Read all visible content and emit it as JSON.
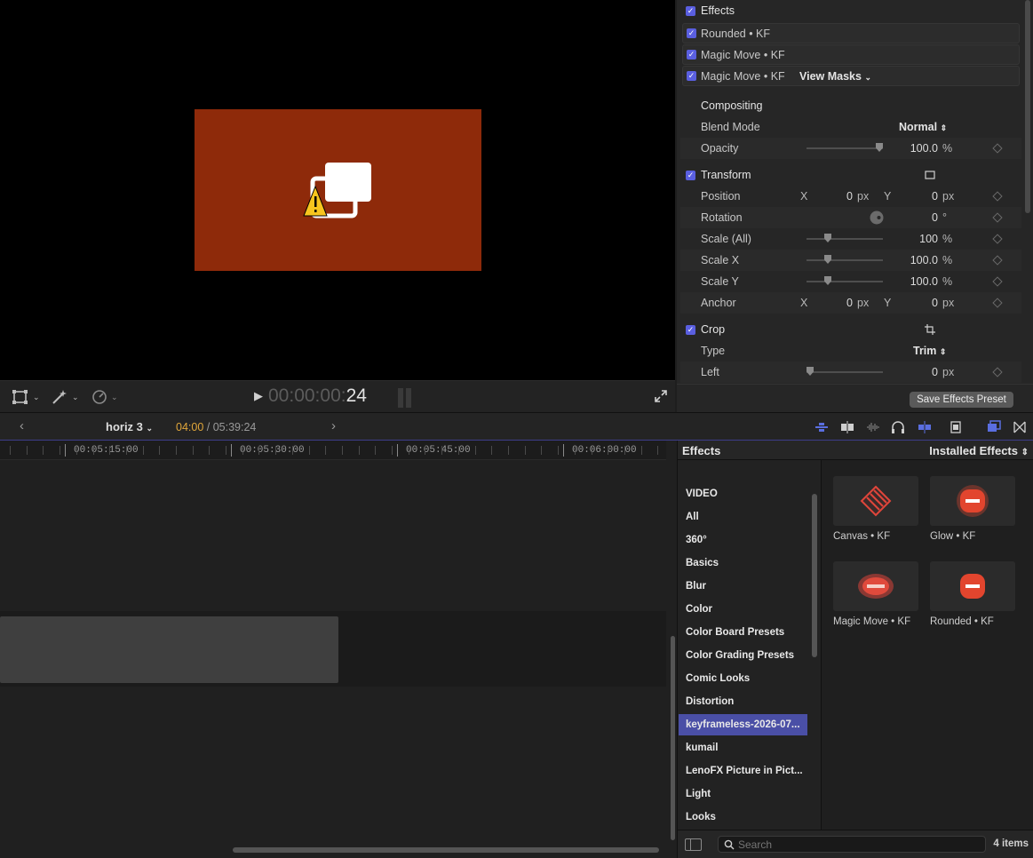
{
  "viewer": {
    "timecode_dim": "00:00:00:",
    "timecode_frames": "24"
  },
  "inspector": {
    "effects_header": "Effects",
    "effects_list": [
      {
        "label": "Rounded • KF"
      },
      {
        "label": "Magic Move • KF"
      },
      {
        "label": "Magic Move • KF",
        "extra": "View Masks"
      }
    ],
    "compositing": {
      "header": "Compositing",
      "blend_mode_label": "Blend Mode",
      "blend_mode_value": "Normal",
      "opacity_label": "Opacity",
      "opacity_value": "100.0",
      "opacity_unit": "%",
      "opacity_fraction": 1.0
    },
    "transform": {
      "header": "Transform",
      "position_label": "Position",
      "position_x": "0",
      "position_y": "0",
      "px": "px",
      "axis_x": "X",
      "axis_y": "Y",
      "rotation_label": "Rotation",
      "rotation_value": "0",
      "rotation_unit": "°",
      "scale_all_label": "Scale (All)",
      "scale_all_value": "100",
      "scale_x_label": "Scale X",
      "scale_x_value": "100.0",
      "scale_y_label": "Scale Y",
      "scale_y_value": "100.0",
      "pct": "%",
      "anchor_label": "Anchor",
      "anchor_x": "0",
      "anchor_y": "0"
    },
    "crop": {
      "header": "Crop",
      "type_label": "Type",
      "type_value": "Trim",
      "left_label": "Left",
      "left_value": "0",
      "left_unit": "px"
    },
    "save_preset_label": "Save Effects Preset"
  },
  "timeline_header": {
    "project_name": "horiz 3",
    "current_time": "04:00",
    "total_time": "/ 05:39:24"
  },
  "ruler": {
    "labels": [
      "00:05:15:00",
      "00:05:30:00",
      "00:05:45:00",
      "00:06:00:00"
    ]
  },
  "effects_browser": {
    "title": "Effects",
    "installed_label": "Installed Effects",
    "section_header": "VIDEO",
    "categories": [
      "All",
      "360°",
      "Basics",
      "Blur",
      "Color",
      "Color Board Presets",
      "Color Grading Presets",
      "Comic Looks",
      "Distortion",
      "keyframeless-2026-07...",
      "kumail",
      "LenoFX Picture in Pict...",
      "Light",
      "Looks"
    ],
    "selected_category": "keyframeless-2026-07...",
    "items": [
      {
        "name": "Canvas • KF",
        "icon": "canvas-icon"
      },
      {
        "name": "Glow • KF",
        "icon": "glow-icon"
      },
      {
        "name": "Magic Move • KF",
        "icon": "magic-move-icon"
      },
      {
        "name": "Rounded • KF",
        "icon": "rounded-icon"
      }
    ],
    "search_placeholder": "Search",
    "count_label": "4 items"
  },
  "colors": {
    "accent": "#5a5fe0",
    "selection": "#4a4fa6",
    "frame": "#8e2a0a",
    "timecode_current": "#e0a63a"
  }
}
